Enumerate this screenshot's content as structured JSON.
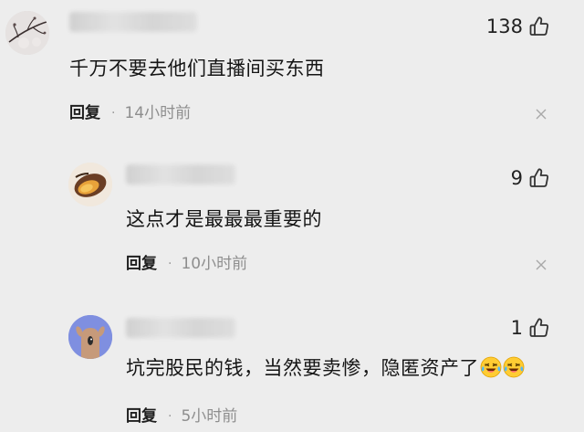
{
  "comments": [
    {
      "likes": "138",
      "text": "千万不要去他们直播间买东西",
      "reply_label": "回复",
      "separator": "·",
      "time": "14小时前",
      "avatar_icon": "winter-branch-avatar",
      "close_icon": "close-icon"
    },
    {
      "likes": "9",
      "text": "这点才是最最最重要的",
      "reply_label": "回复",
      "separator": "·",
      "time": "10小时前",
      "avatar_icon": "sweet-potato-avatar",
      "close_icon": "close-icon"
    },
    {
      "likes": "1",
      "text": "坑完股民的钱，当然要卖惨，隐匿资产了",
      "emojis": [
        "laughing-crying-emoji",
        "laughing-crying-emoji"
      ],
      "reply_label": "回复",
      "separator": "·",
      "time": "5小时前",
      "avatar_icon": "cartoon-creature-avatar",
      "close_icon": "close-icon"
    }
  ],
  "colors": {
    "background": "#ededed",
    "text": "#151515",
    "muted": "#8e8e8e",
    "avatar_blue": "#7f8fe0"
  }
}
